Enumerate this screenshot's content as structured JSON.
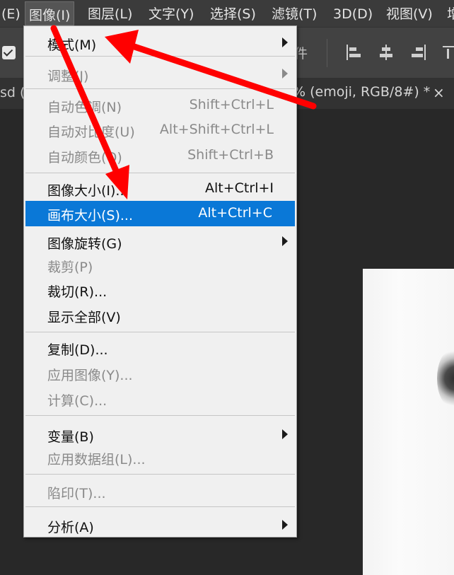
{
  "menubar": {
    "items": [
      {
        "label": "(E)"
      },
      {
        "label": "图像(I)"
      },
      {
        "label": "图层(L)"
      },
      {
        "label": "文字(Y)"
      },
      {
        "label": "选择(S)"
      },
      {
        "label": "滤镜(T)"
      },
      {
        "label": "3D(D)"
      },
      {
        "label": "视图(V)"
      },
      {
        "label": "增"
      }
    ],
    "active_item": "图像(I)"
  },
  "options_bar": {
    "checkbox_checked": true,
    "label": "件",
    "align_icons": [
      "align-left-icon",
      "align-center-icon",
      "align-right-icon",
      "align-top-icon"
    ]
  },
  "tab_bar": {
    "left_text": "sd (",
    "title": "% (emoji, RGB/8#) *",
    "close": "×"
  },
  "menu": {
    "items": [
      {
        "label": "模式(M)",
        "shortcut": "",
        "submenu": true,
        "enabled": true
      },
      {
        "label": "调整(J)",
        "shortcut": "",
        "submenu": true,
        "enabled": false
      },
      {
        "label": "自动色调(N)",
        "shortcut": "Shift+Ctrl+L",
        "submenu": false,
        "enabled": false
      },
      {
        "label": "自动对比度(U)",
        "shortcut": "Alt+Shift+Ctrl+L",
        "submenu": false,
        "enabled": false
      },
      {
        "label": "自动颜色(O)",
        "shortcut": "Shift+Ctrl+B",
        "submenu": false,
        "enabled": false
      },
      {
        "label": "图像大小(I)...",
        "shortcut": "Alt+Ctrl+I",
        "submenu": false,
        "enabled": true
      },
      {
        "label": "画布大小(S)...",
        "shortcut": "Alt+Ctrl+C",
        "submenu": false,
        "enabled": true,
        "highlighted": true
      },
      {
        "label": "图像旋转(G)",
        "shortcut": "",
        "submenu": true,
        "enabled": true
      },
      {
        "label": "裁剪(P)",
        "shortcut": "",
        "submenu": false,
        "enabled": false
      },
      {
        "label": "裁切(R)...",
        "shortcut": "",
        "submenu": false,
        "enabled": true
      },
      {
        "label": "显示全部(V)",
        "shortcut": "",
        "submenu": false,
        "enabled": true
      },
      {
        "label": "复制(D)...",
        "shortcut": "",
        "submenu": false,
        "enabled": true
      },
      {
        "label": "应用图像(Y)...",
        "shortcut": "",
        "submenu": false,
        "enabled": false
      },
      {
        "label": "计算(C)...",
        "shortcut": "",
        "submenu": false,
        "enabled": false
      },
      {
        "label": "变量(B)",
        "shortcut": "",
        "submenu": true,
        "enabled": true
      },
      {
        "label": "应用数据组(L)...",
        "shortcut": "",
        "submenu": false,
        "enabled": false
      },
      {
        "label": "陷印(T)...",
        "shortcut": "",
        "submenu": false,
        "enabled": false
      },
      {
        "label": "分析(A)",
        "shortcut": "",
        "submenu": true,
        "enabled": true
      }
    ]
  },
  "annotation_color": "#ff0000",
  "highlight_color": "#0a78d7"
}
